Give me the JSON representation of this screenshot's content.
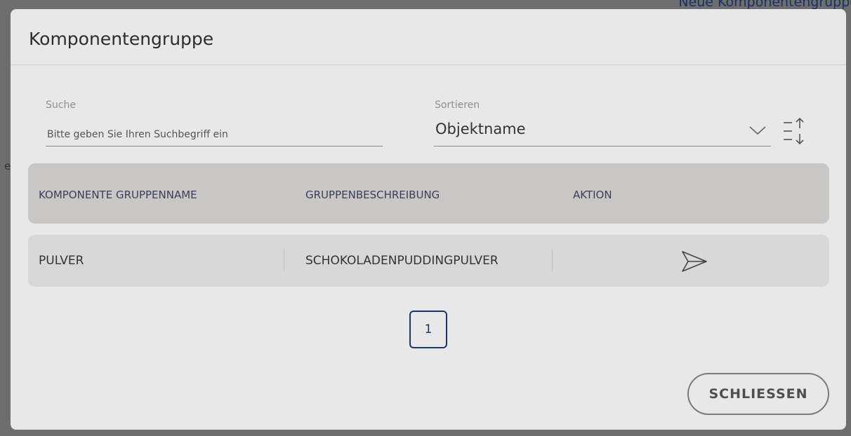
{
  "background": {
    "link_text": "Neue Komponentengruppe",
    "stray_char": "e"
  },
  "modal": {
    "title": "Komponentengruppe"
  },
  "filters": {
    "search": {
      "label": "Suche",
      "placeholder": "Bitte geben Sie Ihren Suchbegriff ein",
      "value": ""
    },
    "sort": {
      "label": "Sortieren",
      "selected": "Objektname",
      "chevron_icon": "chevron-down-icon",
      "order_icon": "sort-order-icon"
    }
  },
  "table": {
    "headers": [
      "KOMPONENTE GRUPPENNAME",
      "GRUPPENBESCHREIBUNG",
      "AKTION"
    ],
    "rows": [
      {
        "name": "PULVER",
        "description": "SCHOKOLADENPUDDINGPULVER",
        "action_icon": "send-icon"
      }
    ]
  },
  "pagination": {
    "current_page": "1"
  },
  "footer": {
    "close_label": "SCHLIESSEN"
  },
  "colors": {
    "accent": "#1e3566",
    "header_bg": "#c9c7c6",
    "row_bg": "#d8d8d8",
    "modal_bg": "#e8e8e8"
  }
}
